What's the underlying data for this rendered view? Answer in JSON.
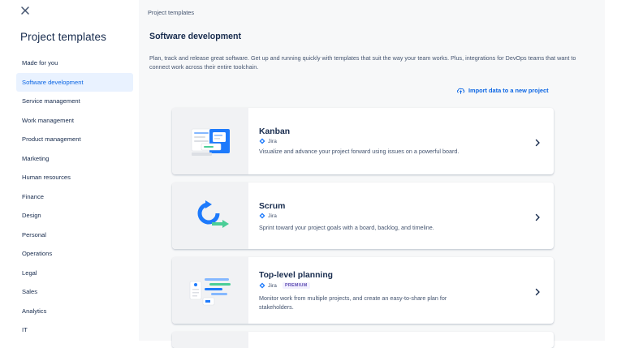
{
  "sidebar": {
    "title": "Project templates",
    "items": [
      {
        "label": "Made for you"
      },
      {
        "label": "Software development",
        "active": true
      },
      {
        "label": "Service management"
      },
      {
        "label": "Work management"
      },
      {
        "label": "Product management"
      },
      {
        "label": "Marketing"
      },
      {
        "label": "Human resources"
      },
      {
        "label": "Finance"
      },
      {
        "label": "Design"
      },
      {
        "label": "Personal"
      },
      {
        "label": "Operations"
      },
      {
        "label": "Legal"
      },
      {
        "label": "Sales"
      },
      {
        "label": "Analytics"
      },
      {
        "label": "IT"
      }
    ]
  },
  "main": {
    "breadcrumb": "Project templates",
    "heading": "Software development",
    "description": "Plan, track and release great software. Get up and running quickly with templates that suit the way your team works. Plus, integrations for DevOps teams that want to connect work across their entire toolchain.",
    "import_label": "Import data to a new project",
    "templates": [
      {
        "title": "Kanban",
        "product": "Jira",
        "description": "Visualize and advance your project forward using issues on a powerful board.",
        "icon": "kanban-illustration"
      },
      {
        "title": "Scrum",
        "product": "Jira",
        "description": "Sprint toward your project goals with a board, backlog, and timeline.",
        "icon": "scrum-illustration"
      },
      {
        "title": "Top-level planning",
        "product": "Jira",
        "badge": "PREMIUM",
        "description": "Monitor work from multiple projects, and create an easy-to-share plan for stakeholders.",
        "icon": "planning-illustration"
      }
    ]
  },
  "colors": {
    "accent": "#0c66e4",
    "active_bg": "#e9f2ff",
    "main_bg": "#f7f8f9",
    "premium": "#5e4db2"
  }
}
